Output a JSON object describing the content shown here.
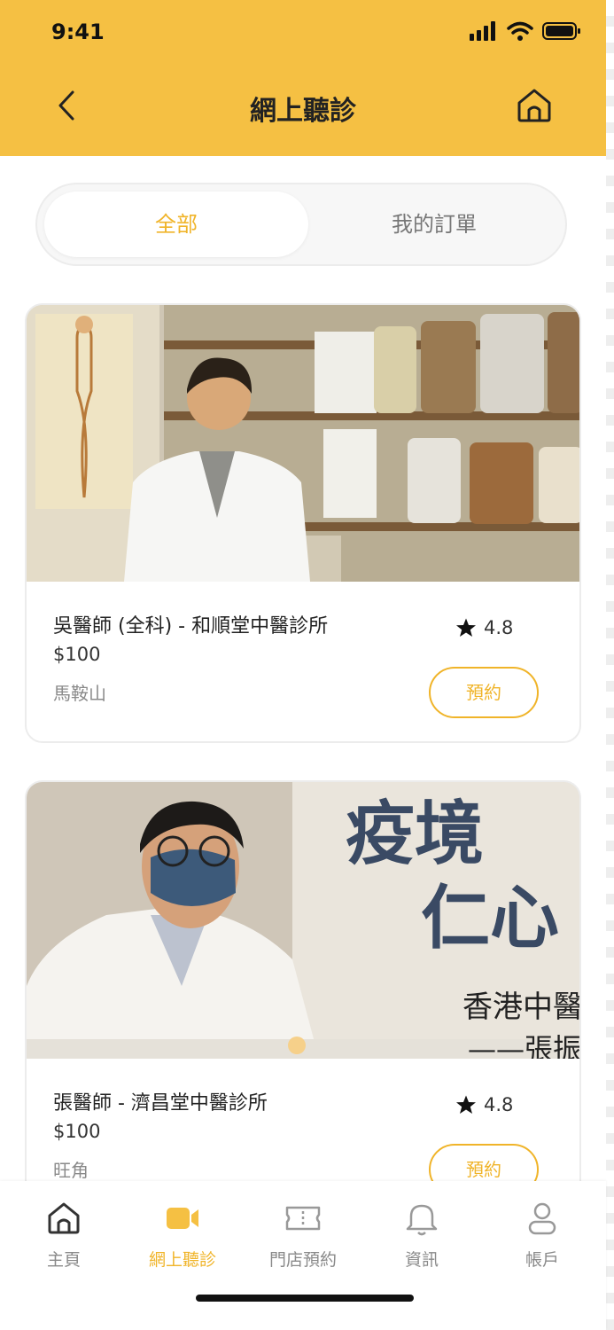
{
  "status": {
    "time": "9:41"
  },
  "header": {
    "title": "網上聽診",
    "back_icon": "chevron-left-icon",
    "home_icon": "home-icon"
  },
  "segment": {
    "tabs": [
      "全部",
      "我的訂單"
    ],
    "active": 0
  },
  "doctors": [
    {
      "name": "吳醫師 (全科) - 和順堂中醫診所",
      "price": "$100",
      "location": "馬鞍山",
      "rating": "4.8",
      "book_label": "預約"
    },
    {
      "name": "張醫師 - 濟昌堂中醫診所",
      "price": "$100",
      "location": "旺角",
      "rating": "4.8",
      "book_label": "預約"
    }
  ],
  "photo2_overlay": {
    "line1": "疫境",
    "line2": "仁心",
    "line3": "香港中醫",
    "line4": "——張振"
  },
  "tabbar": {
    "items": [
      {
        "label": "主頁",
        "icon": "home-icon"
      },
      {
        "label": "網上聽診",
        "icon": "video-icon"
      },
      {
        "label": "門店預約",
        "icon": "ticket-icon"
      },
      {
        "label": "資訊",
        "icon": "bell-icon"
      },
      {
        "label": "帳戶",
        "icon": "user-icon"
      }
    ],
    "active": 1
  },
  "colors": {
    "accent": "#F5C043",
    "accent_text": "#F0B429",
    "muted": "#8a8a8a"
  }
}
